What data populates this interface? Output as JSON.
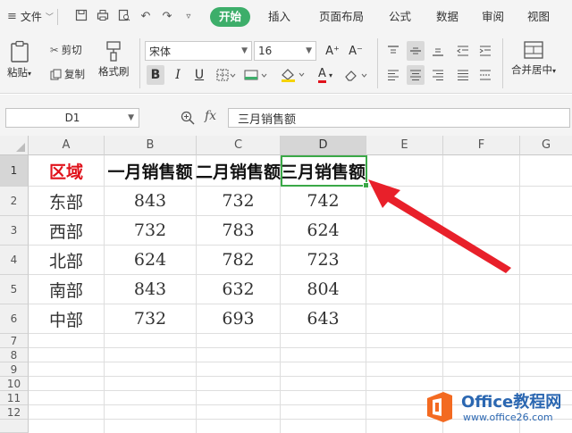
{
  "menu": {
    "file_label": "文件",
    "tabs": [
      "开始",
      "插入",
      "页面布局",
      "公式",
      "数据",
      "审阅",
      "视图"
    ],
    "active_tab": "开始"
  },
  "ribbon": {
    "paste_label": "粘贴",
    "cut_label": "剪切",
    "copy_label": "复制",
    "format_painter_label": "格式刷",
    "font_name": "宋体",
    "font_size": "16",
    "bold_label": "B",
    "italic_label": "I",
    "underline_label": "U",
    "grow_font_label": "A⁺",
    "shrink_font_label": "A⁻",
    "font_color_label": "A",
    "merge_center_label": "合并居中"
  },
  "formula_bar": {
    "name_box": "D1",
    "fx_label": "fx",
    "formula_value": "三月销售额"
  },
  "sheet": {
    "columns": [
      "A",
      "B",
      "C",
      "D",
      "E",
      "F",
      "G"
    ],
    "rows": [
      "1",
      "2",
      "3",
      "4",
      "5",
      "6",
      "7",
      "8",
      "9",
      "10",
      "11",
      "12"
    ],
    "header": [
      "区域",
      "一月销售额",
      "二月销售额",
      "三月销售额"
    ],
    "data": [
      [
        "东部",
        "843",
        "732",
        "742"
      ],
      [
        "西部",
        "732",
        "783",
        "624"
      ],
      [
        "北部",
        "624",
        "782",
        "723"
      ],
      [
        "南部",
        "843",
        "632",
        "804"
      ],
      [
        "中部",
        "732",
        "693",
        "643"
      ]
    ],
    "selected_cell": "D1"
  },
  "watermark": {
    "title": "Office教程网",
    "url": "www.office26.com"
  },
  "colors": {
    "accent_green": "#3dae6a",
    "selection_green": "#3aa847",
    "header_red": "#e0121b",
    "arrow_red": "#e8202a",
    "logo_orange": "#f36a21"
  }
}
